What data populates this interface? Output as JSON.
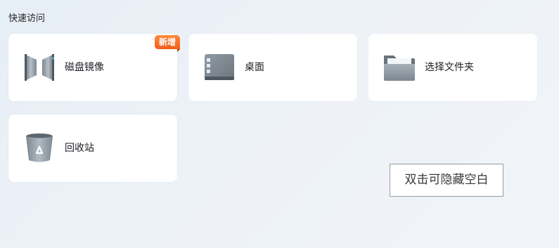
{
  "quick_access": {
    "title": "快速访问",
    "items": [
      {
        "label": "磁盘镜像",
        "icon": "disk-image-icon",
        "badge": "新增"
      },
      {
        "label": "桌面",
        "icon": "desktop-icon"
      },
      {
        "label": "选择文件夹",
        "icon": "folder-icon"
      },
      {
        "label": "回收站",
        "icon": "recycle-bin-icon"
      }
    ]
  },
  "hint_button": {
    "label": "双击可隐藏空白"
  },
  "colors": {
    "badge": "#f25c1c",
    "card_background": "#ffffff",
    "page_background": "#e9eff5"
  }
}
